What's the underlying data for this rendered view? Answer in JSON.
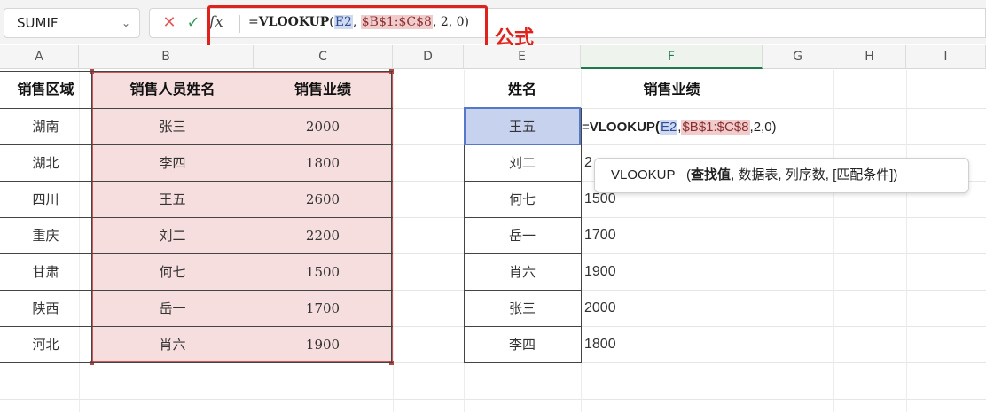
{
  "formula_bar": {
    "name_box": "SUMIF",
    "fx": "fx",
    "formula_prefix": "=",
    "formula_fn": "VLOOKUP",
    "formula_open": "(",
    "formula_ref1": "E2",
    "formula_comma1": ", ",
    "formula_ref2": "$B$1:$C$8",
    "formula_rest": ", 2, 0)"
  },
  "annotation": "公式",
  "columns": [
    "A",
    "B",
    "C",
    "D",
    "E",
    "F",
    "G",
    "H",
    "I"
  ],
  "left_table": {
    "headers": [
      "销售区域",
      "销售人员姓名",
      "销售业绩"
    ],
    "rows": [
      [
        "湖南",
        "张三",
        "2000"
      ],
      [
        "湖北",
        "李四",
        "1800"
      ],
      [
        "四川",
        "王五",
        "2600"
      ],
      [
        "重庆",
        "刘二",
        "2200"
      ],
      [
        "甘肃",
        "何七",
        "1500"
      ],
      [
        "陕西",
        "岳一",
        "1700"
      ],
      [
        "河北",
        "肖六",
        "1900"
      ]
    ]
  },
  "right_table": {
    "headers": [
      "姓名",
      "销售业绩"
    ],
    "names": [
      "王五",
      "刘二",
      "何七",
      "岳一",
      "肖六",
      "张三",
      "李四"
    ],
    "values": [
      "",
      "2",
      "1500",
      "1700",
      "1900",
      "2000",
      "1800"
    ]
  },
  "active_cell_formula": {
    "prefix": "=",
    "fn": "VLOOKUP(",
    "ref1": "E2",
    "comma1": ",",
    "ref2": "$B$1:$C$8",
    "rest": ",2,0)"
  },
  "tooltip": {
    "fn": "VLOOKUP",
    "open": "(",
    "arg1": "查找值",
    "rest": ", 数据表, 列序数, [匹配条件])"
  }
}
